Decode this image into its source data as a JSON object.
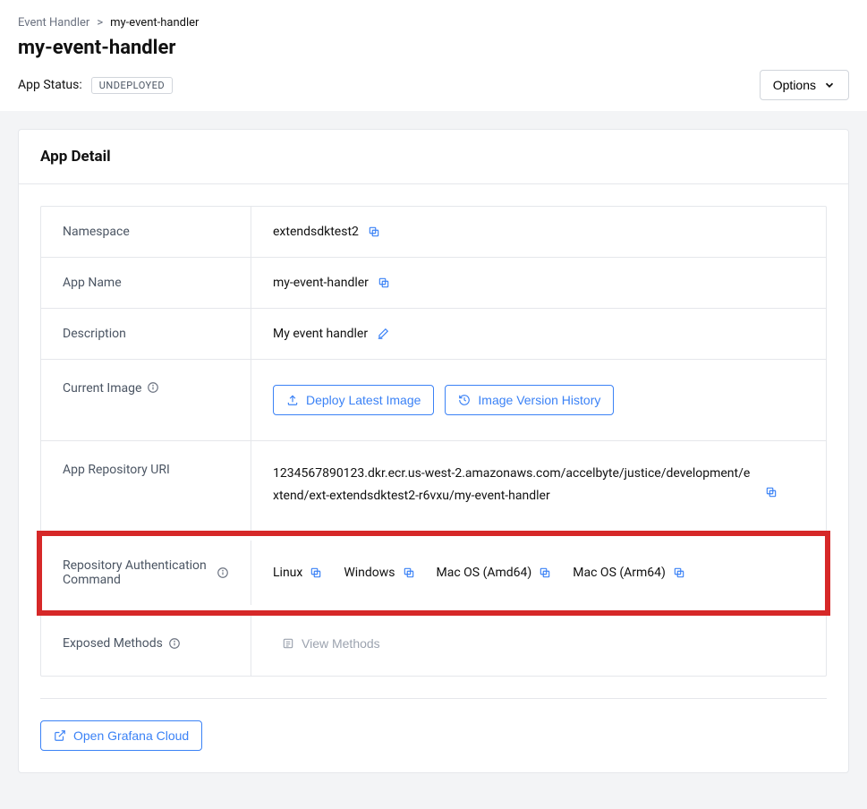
{
  "breadcrumb": {
    "root": "Event Handler",
    "separator": ">",
    "current": "my-event-handler"
  },
  "page_title": "my-event-handler",
  "status": {
    "label": "App Status:",
    "value": "UNDEPLOYED"
  },
  "options_label": "Options",
  "card": {
    "title": "App Detail",
    "rows": {
      "namespace": {
        "label": "Namespace",
        "value": "extendsdktest2"
      },
      "app_name": {
        "label": "App Name",
        "value": "my-event-handler"
      },
      "description": {
        "label": "Description",
        "value": "My event handler"
      },
      "current_image": {
        "label": "Current Image",
        "deploy_btn": "Deploy Latest Image",
        "history_btn": "Image Version History"
      },
      "repo_uri": {
        "label": "App Repository URI",
        "value": "1234567890123.dkr.ecr.us-west-2.amazonaws.com/accelbyte/justice/development/extend/ext-extendsdktest2-r6vxu/my-event-handler"
      },
      "auth_cmd": {
        "label": "Repository Authentication Command",
        "items": [
          "Linux",
          "Windows",
          "Mac OS (Amd64)",
          "Mac OS (Arm64)"
        ]
      },
      "exposed": {
        "label": "Exposed Methods",
        "btn": "View Methods"
      }
    },
    "grafana_btn": "Open Grafana Cloud"
  }
}
